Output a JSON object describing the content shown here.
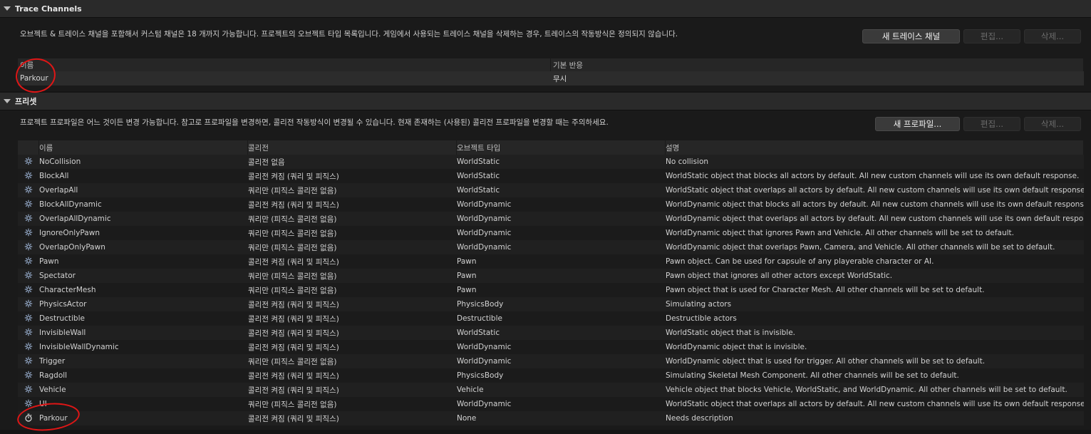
{
  "trace_channels": {
    "title": "Trace Channels",
    "description": "오브젝트 & 트레이스 채널을 포함해서 커스텀 채널은 18 개까지 가능합니다. 프로젝트의 오브젝트 타입 목록입니다. 게임에서 사용되는 트레이스 채널을 삭제하는 경우, 트레이스의 작동방식은 정의되지 않습니다.",
    "buttons": {
      "new": "새 트레이스 채널",
      "edit": "편집...",
      "delete": "삭제..."
    },
    "columns": {
      "name": "이름",
      "default_response": "기본 반응"
    },
    "rows": [
      {
        "name": "Parkour",
        "default_response": "무시"
      }
    ]
  },
  "presets": {
    "title": "프리셋",
    "description": "프로젝트 프로파일은 어느 것이든 변경 가능합니다. 참고로 프로파일을 변경하면, 콜리전 작동방식이 변경될 수 있습니다. 현재 존재하는 (사용된) 콜리전 프로파일을 변경할 때는 주의하세요.",
    "buttons": {
      "new": "새 프로파일...",
      "edit": "편집...",
      "delete": "삭제..."
    },
    "columns": {
      "name": "이름",
      "collision": "콜리전",
      "object_type": "오브젝트 타입",
      "description": "설명"
    },
    "rows": [
      {
        "icon": "gear-icon",
        "name": "NoCollision",
        "collision": "콜리전 없음",
        "object_type": "WorldStatic",
        "description": "No collision"
      },
      {
        "icon": "gear-icon",
        "name": "BlockAll",
        "collision": "콜리전 켜짐 (쿼리 및 피직스)",
        "object_type": "WorldStatic",
        "description": "WorldStatic object that blocks all actors by default. All new custom channels will use its own default response."
      },
      {
        "icon": "gear-icon",
        "name": "OverlapAll",
        "collision": "쿼리만 (피직스 콜리전 없음)",
        "object_type": "WorldStatic",
        "description": "WorldStatic object that overlaps all actors by default. All new custom channels will use its own default response."
      },
      {
        "icon": "gear-icon",
        "name": "BlockAllDynamic",
        "collision": "콜리전 켜짐 (쿼리 및 피직스)",
        "object_type": "WorldDynamic",
        "description": "WorldDynamic object that blocks all actors by default. All new custom channels will use its own default response."
      },
      {
        "icon": "gear-icon",
        "name": "OverlapAllDynamic",
        "collision": "쿼리만 (피직스 콜리전 없음)",
        "object_type": "WorldDynamic",
        "description": "WorldDynamic object that overlaps all actors by default. All new custom channels will use its own default response."
      },
      {
        "icon": "gear-icon",
        "name": "IgnoreOnlyPawn",
        "collision": "쿼리만 (피직스 콜리전 없음)",
        "object_type": "WorldDynamic",
        "description": "WorldDynamic object that ignores Pawn and Vehicle. All other channels will be set to default."
      },
      {
        "icon": "gear-icon",
        "name": "OverlapOnlyPawn",
        "collision": "쿼리만 (피직스 콜리전 없음)",
        "object_type": "WorldDynamic",
        "description": "WorldDynamic object that overlaps Pawn, Camera, and Vehicle. All other channels will be set to default."
      },
      {
        "icon": "gear-icon",
        "name": "Pawn",
        "collision": "콜리전 켜짐 (쿼리 및 피직스)",
        "object_type": "Pawn",
        "description": "Pawn object. Can be used for capsule of any playerable character or AI."
      },
      {
        "icon": "gear-icon",
        "name": "Spectator",
        "collision": "쿼리만 (피직스 콜리전 없음)",
        "object_type": "Pawn",
        "description": "Pawn object that ignores all other actors except WorldStatic."
      },
      {
        "icon": "gear-icon",
        "name": "CharacterMesh",
        "collision": "쿼리만 (피직스 콜리전 없음)",
        "object_type": "Pawn",
        "description": "Pawn object that is used for Character Mesh. All other channels will be set to default."
      },
      {
        "icon": "gear-icon",
        "name": "PhysicsActor",
        "collision": "콜리전 켜짐 (쿼리 및 피직스)",
        "object_type": "PhysicsBody",
        "description": "Simulating actors"
      },
      {
        "icon": "gear-icon",
        "name": "Destructible",
        "collision": "콜리전 켜짐 (쿼리 및 피직스)",
        "object_type": "Destructible",
        "description": "Destructible actors"
      },
      {
        "icon": "gear-icon",
        "name": "InvisibleWall",
        "collision": "콜리전 켜짐 (쿼리 및 피직스)",
        "object_type": "WorldStatic",
        "description": "WorldStatic object that is invisible."
      },
      {
        "icon": "gear-icon",
        "name": "InvisibleWallDynamic",
        "collision": "콜리전 켜짐 (쿼리 및 피직스)",
        "object_type": "WorldDynamic",
        "description": "WorldDynamic object that is invisible."
      },
      {
        "icon": "gear-icon",
        "name": "Trigger",
        "collision": "쿼리만 (피직스 콜리전 없음)",
        "object_type": "WorldDynamic",
        "description": "WorldDynamic object that is used for trigger. All other channels will be set to default."
      },
      {
        "icon": "gear-icon",
        "name": "Ragdoll",
        "collision": "콜리전 켜짐 (쿼리 및 피직스)",
        "object_type": "PhysicsBody",
        "description": "Simulating Skeletal Mesh Component. All other channels will be set to default."
      },
      {
        "icon": "gear-icon",
        "name": "Vehicle",
        "collision": "콜리전 켜짐 (쿼리 및 피직스)",
        "object_type": "Vehicle",
        "description": "Vehicle object that blocks Vehicle, WorldStatic, and WorldDynamic. All other channels will be set to default."
      },
      {
        "icon": "gear-icon",
        "name": "UI",
        "collision": "쿼리만 (피직스 콜리전 없음)",
        "object_type": "WorldDynamic",
        "description": "WorldStatic object that overlaps all actors by default. All new custom channels will use its own default response."
      },
      {
        "icon": "stopwatch-icon",
        "name": "Parkour",
        "collision": "콜리전 켜짐 (쿼리 및 피직스)",
        "object_type": "None",
        "description": "Needs description"
      }
    ]
  },
  "colors": {
    "annotation": "#e01616",
    "background": "#1a1a1a",
    "header": "#2a2a2a"
  }
}
